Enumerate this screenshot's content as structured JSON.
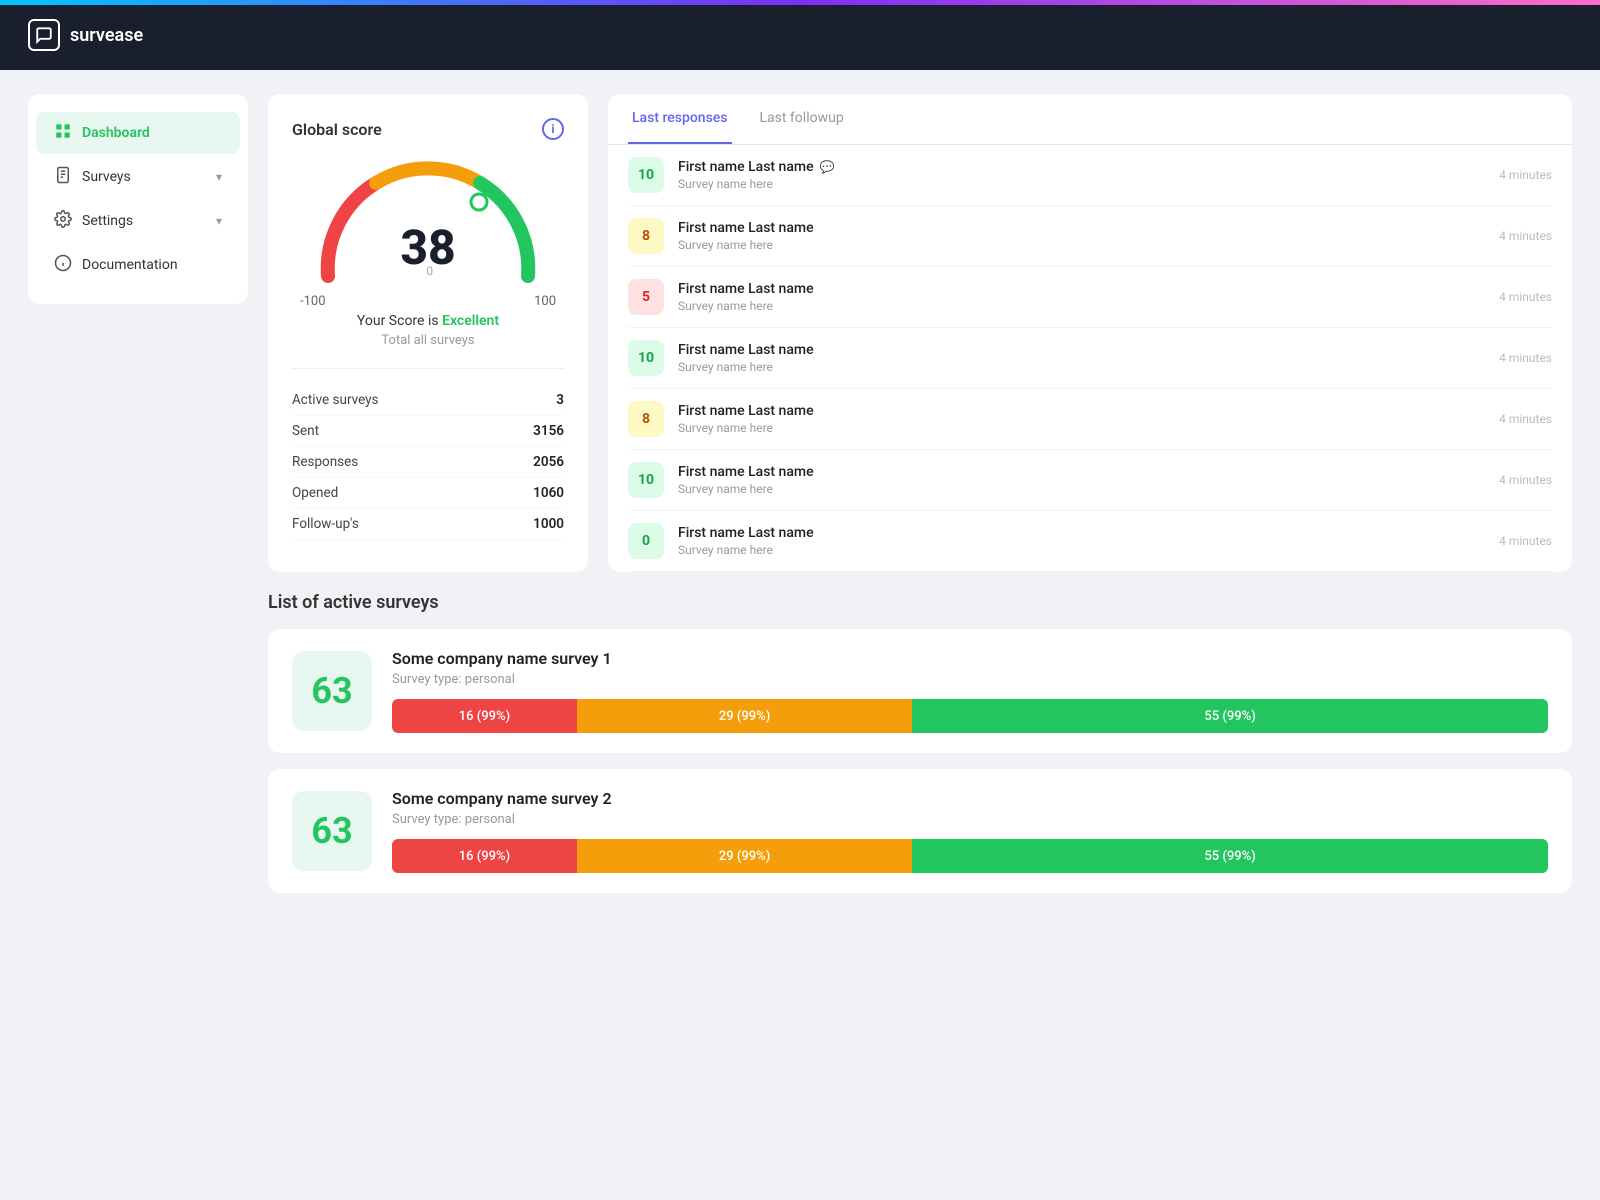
{
  "app": {
    "name": "survease",
    "logo_icon": "💬"
  },
  "sidebar": {
    "items": [
      {
        "id": "dashboard",
        "label": "Dashboard",
        "icon": "⊞",
        "active": true,
        "has_chevron": false
      },
      {
        "id": "surveys",
        "label": "Surveys",
        "icon": "📋",
        "active": false,
        "has_chevron": true
      },
      {
        "id": "settings",
        "label": "Settings",
        "icon": "⚙",
        "active": false,
        "has_chevron": true
      },
      {
        "id": "documentation",
        "label": "Documentation",
        "icon": "❓",
        "active": false,
        "has_chevron": false
      }
    ]
  },
  "score_card": {
    "title": "Global score",
    "score": 38,
    "min": -100,
    "max": 100,
    "score_label": "Your Score is",
    "score_quality": "Excellent",
    "score_sublabel": "Total all surveys",
    "info_icon": "i",
    "stats": [
      {
        "label": "Active surveys",
        "value": "3"
      },
      {
        "label": "Sent",
        "value": "3156"
      },
      {
        "label": "Responses",
        "value": "2056"
      },
      {
        "label": "Opened",
        "value": "1060"
      },
      {
        "label": "Follow-up's",
        "value": "1000"
      }
    ]
  },
  "responses": {
    "tabs": [
      {
        "id": "last-responses",
        "label": "Last responses",
        "active": true
      },
      {
        "id": "last-followup",
        "label": "Last followup",
        "active": false
      }
    ],
    "items": [
      {
        "score": 10,
        "badge_type": "green",
        "name": "First name Last name",
        "survey": "Survey name here",
        "time": "4 minutes",
        "has_chat": true
      },
      {
        "score": 8,
        "badge_type": "yellow",
        "name": "First name Last name",
        "survey": "Survey name here",
        "time": "4 minutes",
        "has_chat": false
      },
      {
        "score": 5,
        "badge_type": "red",
        "name": "First name Last name",
        "survey": "Survey name here",
        "time": "4 minutes",
        "has_chat": false
      },
      {
        "score": 10,
        "badge_type": "green",
        "name": "First name Last name",
        "survey": "Survey name here",
        "time": "4 minutes",
        "has_chat": false
      },
      {
        "score": 8,
        "badge_type": "yellow",
        "name": "First name Last name",
        "survey": "Survey name here",
        "time": "4 minutes",
        "has_chat": false
      },
      {
        "score": 10,
        "badge_type": "green",
        "name": "First name Last name",
        "survey": "Survey name here",
        "time": "4 minutes",
        "has_chat": false
      },
      {
        "score": 0,
        "badge_type": "green",
        "name": "First name Last name",
        "survey": "Survey name here",
        "time": "4 minutes",
        "has_chat": false
      }
    ]
  },
  "surveys_section": {
    "title": "List of active surveys",
    "surveys": [
      {
        "id": "survey1",
        "score": 63,
        "name": "Some company name survey 1",
        "type": "Survey type: personal",
        "bar": [
          {
            "label": "16 (99%)",
            "pct": 16,
            "color": "red"
          },
          {
            "label": "29 (99%)",
            "pct": 29,
            "color": "yellow"
          },
          {
            "label": "55 (99%)",
            "pct": 55,
            "color": "green"
          }
        ]
      },
      {
        "id": "survey2",
        "score": 63,
        "name": "Some company name survey 2",
        "type": "Survey type: personal",
        "bar": [
          {
            "label": "16 (99%)",
            "pct": 16,
            "color": "red"
          },
          {
            "label": "29 (99%)",
            "pct": 29,
            "color": "yellow"
          },
          {
            "label": "55 (99%)",
            "pct": 55,
            "color": "green"
          }
        ]
      }
    ]
  }
}
